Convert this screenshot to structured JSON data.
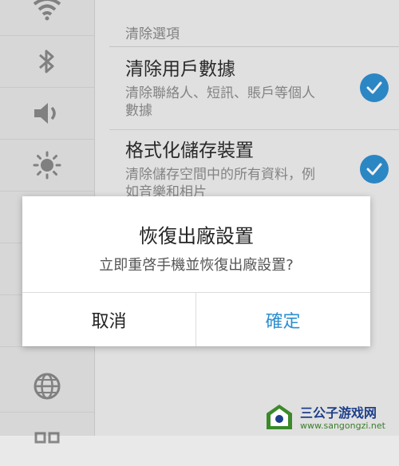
{
  "rail": {
    "icons": [
      "wifi-icon",
      "bluetooth-icon",
      "volume-icon",
      "brightness-icon",
      "blank",
      "blank",
      "blank",
      "globe-icon",
      "grid-icon"
    ]
  },
  "panel": {
    "section_header": "清除選項",
    "options": [
      {
        "title": "清除用戶數據",
        "desc": "清除聯絡人、短訊、賬戶等個人數據",
        "checked": true
      },
      {
        "title": "格式化儲存裝置",
        "desc": "清除儲存空間中的所有資料，例如音樂和相片",
        "checked": true
      }
    ]
  },
  "dialog": {
    "title": "恢復出廠設置",
    "message": "立即重啓手機並恢復出廠設置?",
    "cancel_label": "取消",
    "ok_label": "確定"
  },
  "watermark": {
    "brand": "三公子游戏网",
    "url": "www.sangongzi.net"
  },
  "colors": {
    "accent": "#2e8fd1",
    "background": "#eeeeee",
    "dialog_bg": "#ffffff"
  }
}
